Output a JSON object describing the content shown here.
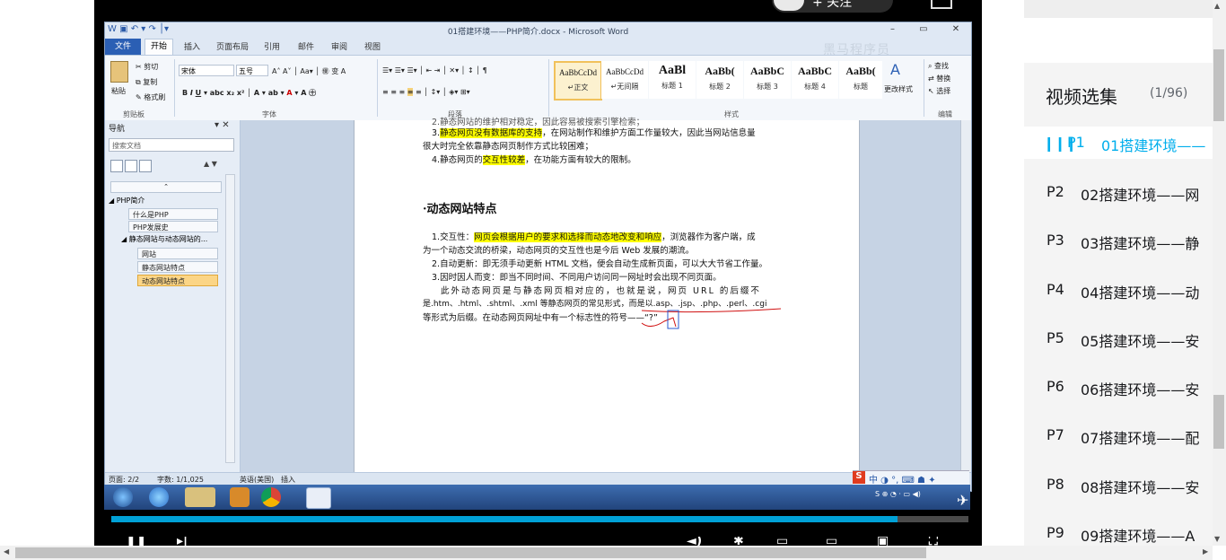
{
  "player": {
    "follow": "+ 关注"
  },
  "word": {
    "title": "01搭建环境——PHP简介.docx - Microsoft Word",
    "tabs": [
      "文件",
      "开始",
      "插入",
      "页面布局",
      "引用",
      "邮件",
      "审阅",
      "视图"
    ],
    "watermark": "黑马程序员",
    "ribbon": {
      "clipboard": {
        "paste": "粘贴",
        "cut": "剪切",
        "copy": "复制",
        "format_painter": "格式刷",
        "label": "剪贴板"
      },
      "font": {
        "name": "宋体",
        "size": "五号",
        "label": "字体"
      },
      "paragraph": {
        "label": "段落"
      },
      "styles": {
        "label": "样式",
        "items": [
          {
            "sample": "AaBbCcDd",
            "name": "↵正文"
          },
          {
            "sample": "AaBbCcDd",
            "name": "↵无间隔"
          },
          {
            "sample": "AaBl",
            "name": "标题 1"
          },
          {
            "sample": "AaBb(",
            "name": "标题 2"
          },
          {
            "sample": "AaBbC",
            "name": "标题 3"
          },
          {
            "sample": "AaBbC",
            "name": "标题 4"
          },
          {
            "sample": "AaBb(",
            "name": "标题"
          }
        ],
        "change": "更改样式"
      },
      "editing": {
        "find": "查找",
        "replace": "替换",
        "select": "选择",
        "label": "编辑"
      }
    },
    "nav": {
      "title": "导航",
      "search_placeholder": "搜索文档",
      "items": [
        {
          "label": "PHP简介"
        },
        {
          "label": "什么是PHP"
        },
        {
          "label": "PHP发展史"
        },
        {
          "label": "静态网站与动态网站的..."
        },
        {
          "label": "网站"
        },
        {
          "label": "静态网站特点"
        },
        {
          "label": "动态网站特点"
        }
      ]
    },
    "doc": {
      "line0": "2.静态网站的维护相对稳定，因此容易被搜索引擎检索；",
      "line1_a": "3.",
      "line1_hl": "静态网页没有数据库的支持",
      "line1_b": "，在网站制作和维护方面工作量较大，因此当网站信息量",
      "line2": "很大时完全依靠静态网页制作方式比较困难；",
      "line3_a": "4.静态网页的",
      "line3_hl": "交互性较差",
      "line3_b": "，在功能方面有较大的限制。",
      "heading": "·动态网站特点",
      "p1_a": "1.交互性：",
      "p1_hl": "网页会根据用户的要求和选择而动态地改变和响应",
      "p1_b": "，浏览器作为客户端，成",
      "p2": "为一个动态交流的桥梁，动态网页的交互性也是今后 Web 发展的潮流。",
      "p3": "2.自动更新：即无须手动更新 HTML 文档，便会自动生成新页面，可以大大节省工作量。",
      "p4": "3.因时因人而变：即当不同时间、不同用户访问同一网址时会出现不同页面。",
      "p5": "此外动态网页是与静态网页相对应的，也就是说，网页 URL 的后缀不",
      "p6": "是.htm、.html、.shtml、.xml 等静态网页的常见形式，而是以.asp、.jsp、.php、.perl、.cgi",
      "p7": "等形式为后缀。在动态网页网址中有一个标志性的符号——“?”"
    },
    "status": {
      "page": "页面: 2/2",
      "words": "字数: 1/1,025",
      "lang": "英语(美国)",
      "mode": "插入"
    }
  },
  "sidebar": {
    "title": "视频选集",
    "count": "(1/96)",
    "episodes": [
      {
        "num": "P1",
        "name": "01搭建环境——"
      },
      {
        "num": "P2",
        "name": "02搭建环境——网"
      },
      {
        "num": "P3",
        "name": "03搭建环境——静"
      },
      {
        "num": "P4",
        "name": "04搭建环境——动"
      },
      {
        "num": "P5",
        "name": "05搭建环境——安"
      },
      {
        "num": "P6",
        "name": "06搭建环境——安"
      },
      {
        "num": "P7",
        "name": "07搭建环境——配"
      },
      {
        "num": "P8",
        "name": "08搭建环境——安"
      },
      {
        "num": "P9",
        "name": "09搭建环境——A"
      }
    ]
  },
  "colors": {
    "accent": "#00aeec",
    "progress": "#00a1d6",
    "highlight": "#ffff00"
  }
}
